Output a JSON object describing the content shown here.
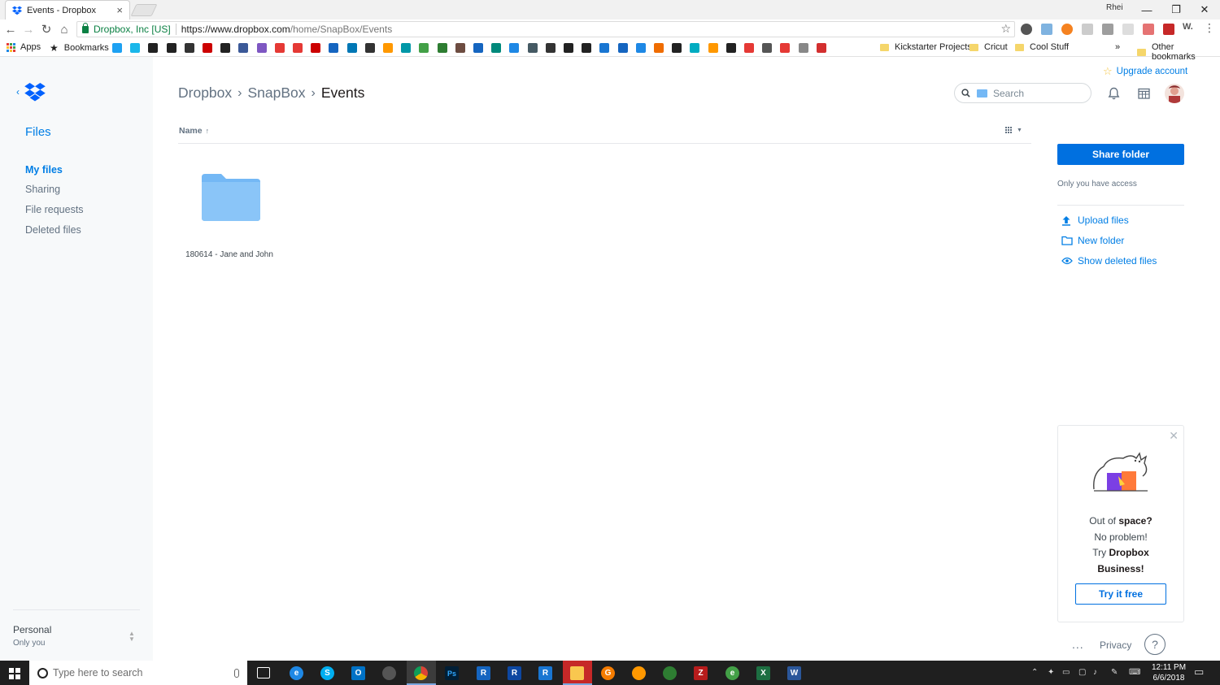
{
  "browser": {
    "tab_title": "Events - Dropbox",
    "tab_close": "×",
    "window_user": "Rhei",
    "controls": {
      "minimize": "—",
      "restore": "❐",
      "close": "✕"
    },
    "secure_label": "Dropbox, Inc [US]",
    "url_host": "https://www.dropbox.com",
    "url_path": "/home/SnapBox/Events",
    "bookmarks": {
      "apps": "Apps",
      "bookmarks": "Bookmarks",
      "kickstarter": "Kickstarter Projects",
      "cricut": "Cricut",
      "cool_stuff": "Cool Stuff",
      "overflow": "»",
      "other": "Other bookmarks"
    },
    "icon_colors": [
      "#1da1f2",
      "#1ab7ea",
      "#222",
      "#222",
      "#333",
      "#c00",
      "#222",
      "#3b5998",
      "#7e57c2",
      "#e53935",
      "#e53935",
      "#c00",
      "#1565c0",
      "#0077b5",
      "#333",
      "#ff9800",
      "#0097a7",
      "#43a047",
      "#2e7d32",
      "#6d4c41",
      "#1565c0",
      "#00897b",
      "#1e88e5",
      "#455a64",
      "#333",
      "#222",
      "#222",
      "#1976d2",
      "#1565c0",
      "#1e88e5",
      "#ef6c00",
      "#222",
      "#00acc1",
      "#ff9800",
      "#222",
      "#e53935",
      "#555",
      "#e53935",
      "#888",
      "#d32f2f"
    ]
  },
  "sidebar": {
    "files_heading": "Files",
    "items": [
      {
        "label": "My files",
        "active": true
      },
      {
        "label": "Sharing",
        "active": false
      },
      {
        "label": "File requests",
        "active": false
      },
      {
        "label": "Deleted files",
        "active": false
      }
    ],
    "account_name": "Personal",
    "account_sub": "Only you"
  },
  "header": {
    "breadcrumb": [
      "Dropbox",
      "SnapBox",
      "Events"
    ],
    "search_placeholder": "Search",
    "upgrade": "Upgrade account"
  },
  "listing": {
    "sort_column": "Name",
    "sort_arrow": "↑",
    "items": [
      {
        "name": "180614 - Jane and John",
        "type": "folder"
      }
    ]
  },
  "details": {
    "share_button": "Share folder",
    "access_text": "Only you have access",
    "actions": {
      "upload": "Upload files",
      "new_folder": "New folder",
      "show_deleted": "Show deleted files"
    }
  },
  "promo": {
    "line1_prefix": "Out of ",
    "line1_bold": "space?",
    "line2": "No problem!",
    "line3_prefix": "Try ",
    "line3_bold": "Dropbox",
    "line4_bold": "Business!",
    "button": "Try it free"
  },
  "footer": {
    "more": "...",
    "privacy": "Privacy",
    "help": "?"
  },
  "taskbar": {
    "search_placeholder": "Type here to search",
    "time": "12:11 PM",
    "date": "6/6/2018"
  },
  "colors": {
    "accent": "#007ee5",
    "button": "#0070e0",
    "folder": "#74b8f5"
  }
}
